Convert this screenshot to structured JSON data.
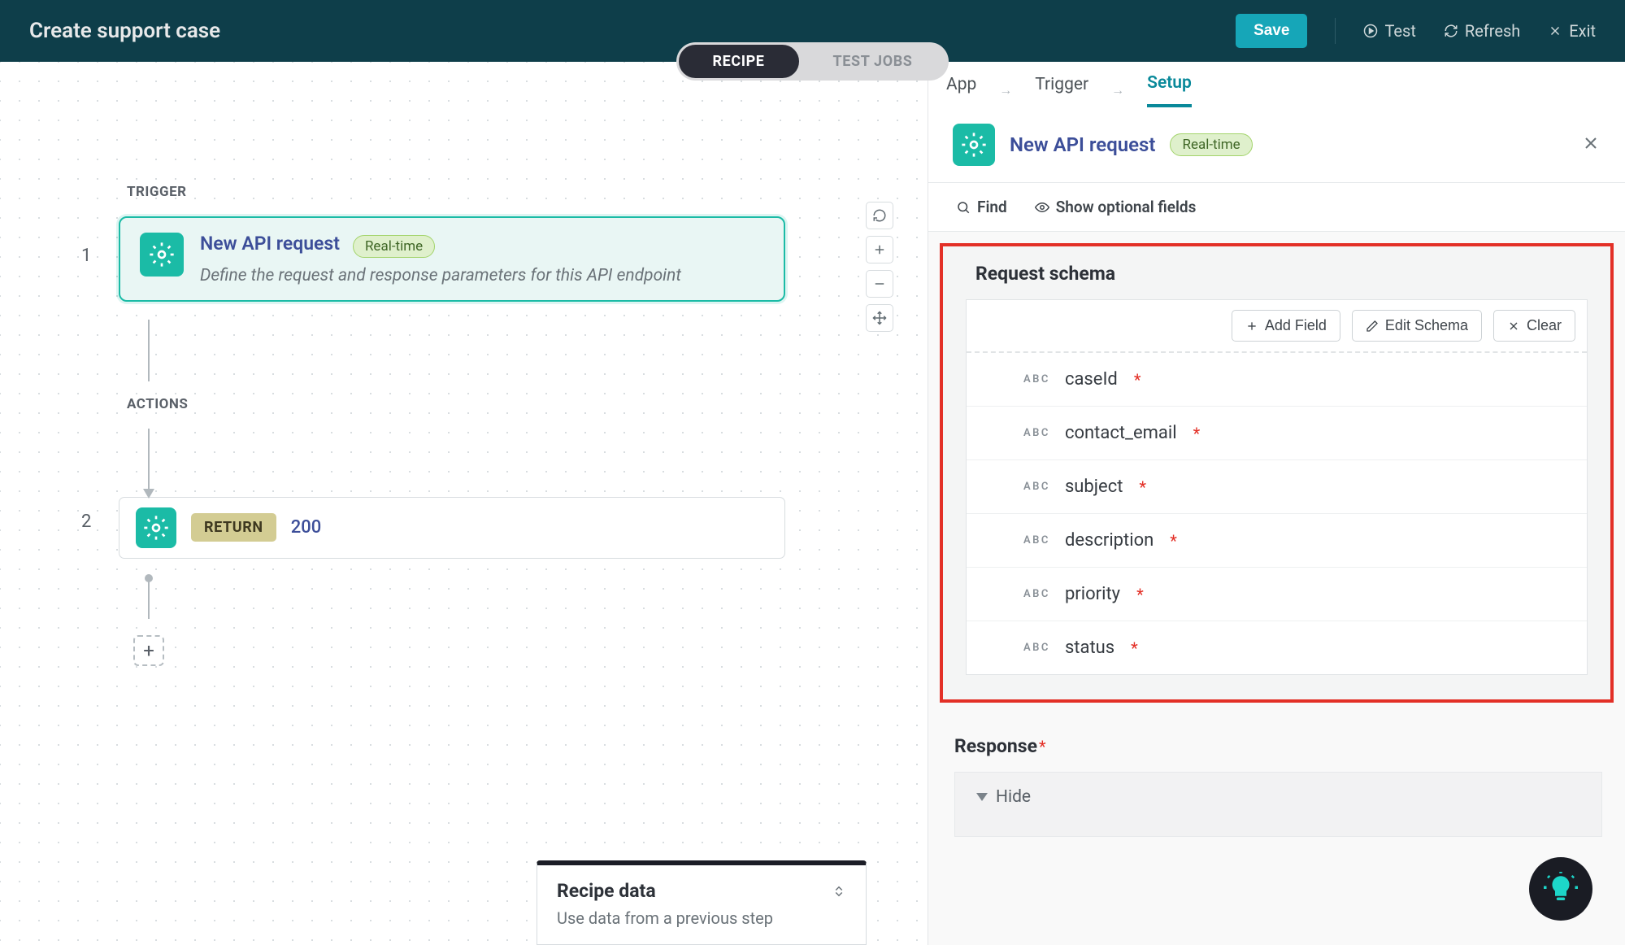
{
  "topbar": {
    "title": "Create support case",
    "save_label": "Save",
    "test_label": "Test",
    "refresh_label": "Refresh",
    "exit_label": "Exit"
  },
  "tabs": {
    "recipe": "RECIPE",
    "test_jobs": "TEST JOBS"
  },
  "canvas": {
    "trigger_label": "TRIGGER",
    "actions_label": "ACTIONS",
    "step1_num": "1",
    "step2_num": "2",
    "trigger_title": "New API request",
    "badge_realtime": "Real-time",
    "trigger_desc": "Define the request and response parameters for this API endpoint",
    "return_tag": "RETURN",
    "return_value": "200",
    "add_step": "+"
  },
  "recipe_data": {
    "title": "Recipe data",
    "sub": "Use data from a previous step"
  },
  "panel": {
    "tabs": {
      "app": "App",
      "trigger": "Trigger",
      "setup": "Setup"
    },
    "header_title": "New API request",
    "badge_realtime": "Real-time",
    "find_label": "Find",
    "show_optional_label": "Show optional fields",
    "schema_title": "Request schema",
    "actions": {
      "add_field": "Add Field",
      "edit_schema": "Edit Schema",
      "clear": "Clear"
    },
    "field_type_abc": "ABC",
    "fields": [
      {
        "name": "caseId",
        "required": true
      },
      {
        "name": "contact_email",
        "required": true
      },
      {
        "name": "subject",
        "required": true
      },
      {
        "name": "description",
        "required": true
      },
      {
        "name": "priority",
        "required": true
      },
      {
        "name": "status",
        "required": true
      }
    ],
    "response_label": "Response",
    "hide_label": "Hide"
  }
}
